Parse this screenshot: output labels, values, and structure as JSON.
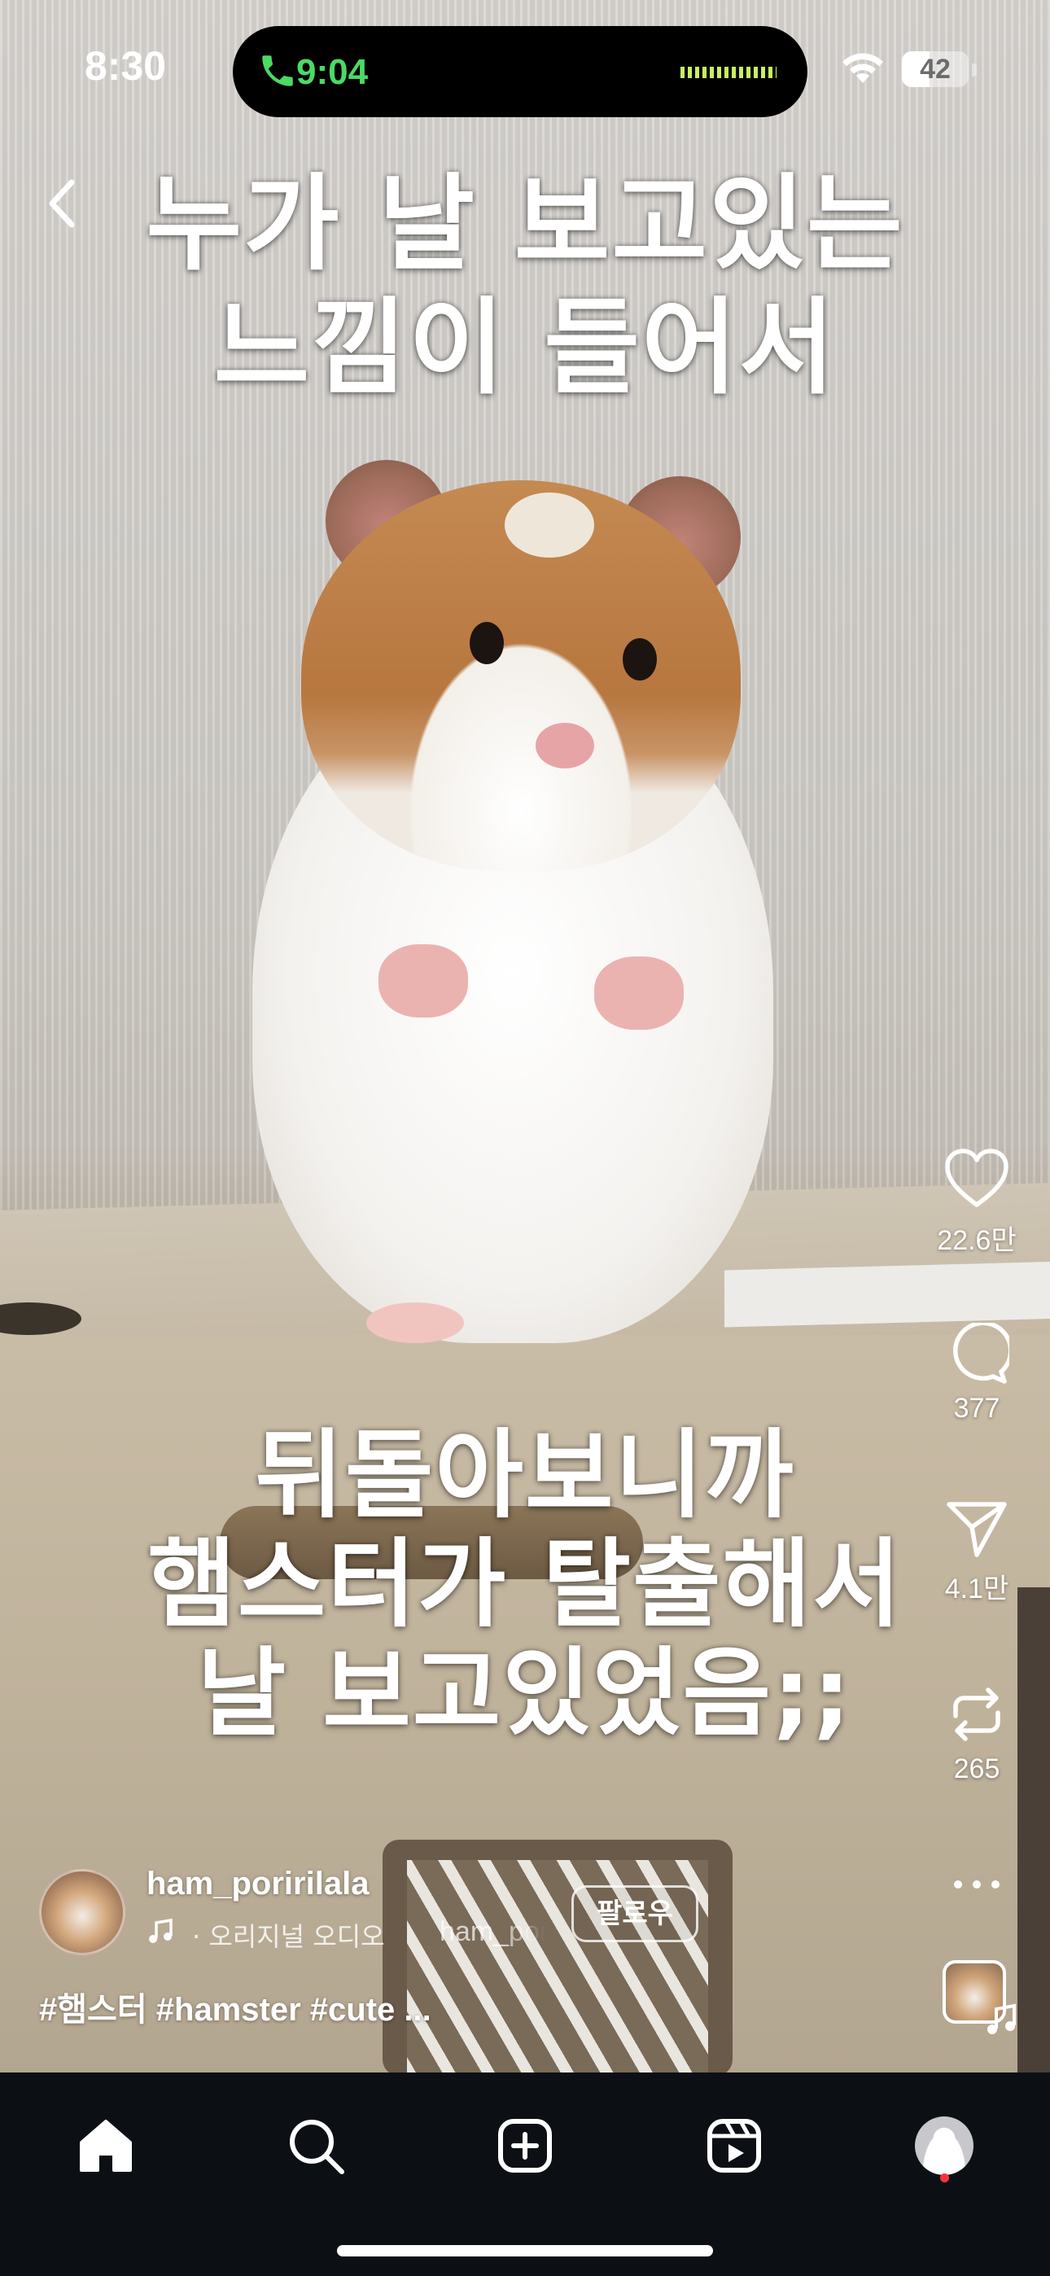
{
  "status_bar": {
    "time": "8:30",
    "call_timer": "9:04",
    "battery_level": "42",
    "battery_percent": 42
  },
  "video": {
    "caption_top": [
      "누가 날 보고있는",
      "느낌이 들어서"
    ],
    "caption_bottom": [
      "뒤돌아보니까",
      "햄스터가 탈출해서",
      "날 보고있었음;;"
    ]
  },
  "actions": {
    "likes": "22.6만",
    "comments": "377",
    "shares": "4.1만",
    "remixes": "265"
  },
  "post": {
    "username": "ham_poririlala",
    "audio_label": "· 오리지널 오디오",
    "audio_scroll": "ham_poririlala",
    "follow_label": "팔로우",
    "caption": "#햄스터 #hamster #cute ..."
  },
  "tabs": [
    "home",
    "search",
    "create",
    "reels",
    "profile"
  ],
  "colors": {
    "call_green": "#4cd964",
    "tab_bar_bg": "#0c1014",
    "notification_dot": "#ff3040"
  },
  "icons": [
    "back-chevron-icon",
    "heart-icon",
    "comment-icon",
    "send-icon",
    "repost-icon",
    "more-icon",
    "music-note-icon",
    "home-icon",
    "search-icon",
    "create-icon",
    "reels-icon",
    "profile-icon"
  ]
}
